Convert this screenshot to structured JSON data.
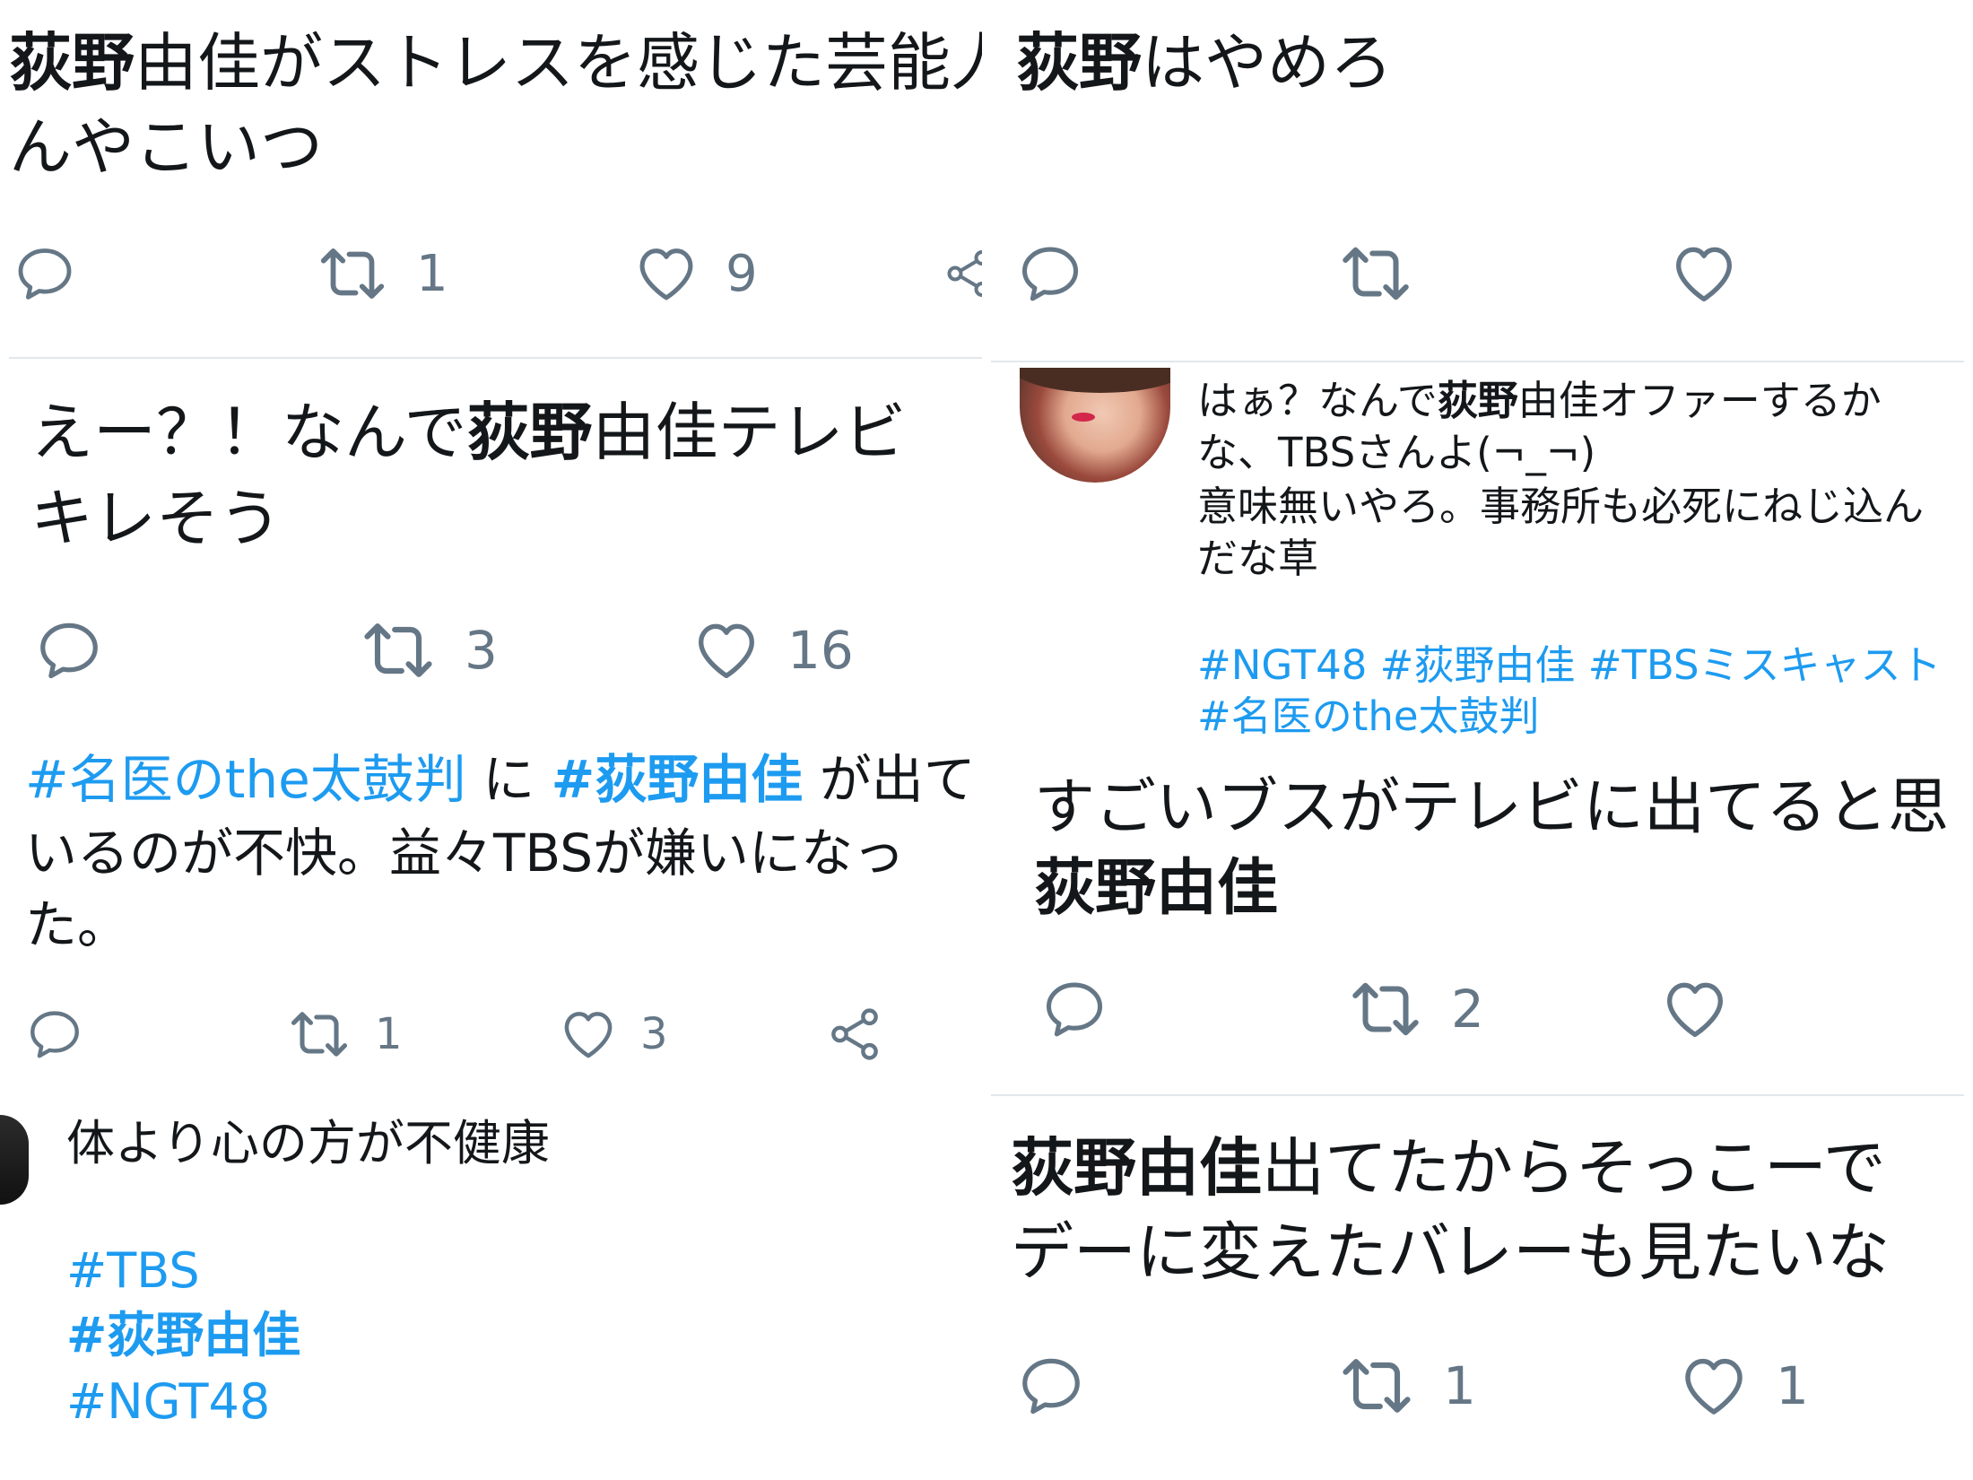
{
  "tweets": {
    "t1": {
      "line1_bold": "荻野",
      "line1_rest": "由佳がストレスを感じた芸能人",
      "line2": "んやこいつ",
      "retweets": "1",
      "likes": "9"
    },
    "t2": {
      "line1_bold": "荻野",
      "line1_rest": "はやめろ"
    },
    "t3": {
      "line1_a": "えー？！なんで",
      "line1_bold": "荻野",
      "line1_rest": "由佳テレビ",
      "line2": "キレそう",
      "retweets": "3",
      "likes": "16"
    },
    "t4": {
      "line1_a": "はぁ？なんで",
      "line1_bold": "荻野",
      "line1_rest": "由佳オファーするか",
      "line2": "な、TBSさんよ(¬_¬)",
      "line3": "意味無いやろ。事務所も必死にねじ込ん",
      "line4": "だな草",
      "tags_line1": "#NGT48 #荻野由佳 #TBSミスキャスト",
      "tags_line2": "#名医のthe太鼓判"
    },
    "t5": {
      "tag1": "#名医のthe太鼓判",
      "mid": " に ",
      "tag2": "#荻野由佳",
      "line1_rest": " が出て",
      "line2": "いるのが不快。益々TBSが嫌いになっ",
      "line3": "た。",
      "retweets": "1",
      "likes": "3"
    },
    "t6": {
      "line1": "すごいブスがテレビに出てると思",
      "line2_bold": "荻野由佳",
      "retweets": "2"
    },
    "t7": {
      "line1": "体より心の方が不健康",
      "tag1": "#TBS",
      "tag2": "#荻野由佳",
      "tag3": "#NGT48"
    },
    "t8": {
      "line1_bold": "荻野由佳",
      "line1_rest": "出てたからそっこーで",
      "line2": "デーに変えたバレーも見たいな",
      "retweets": "1",
      "likes": "1"
    }
  },
  "icons": {
    "reply": "reply-icon",
    "retweet": "retweet-icon",
    "like": "heart-icon",
    "share": "share-icon"
  },
  "colors": {
    "hashtag": "#1d9bf0",
    "action_gray": "#657786",
    "divider": "#e1e8ed"
  }
}
